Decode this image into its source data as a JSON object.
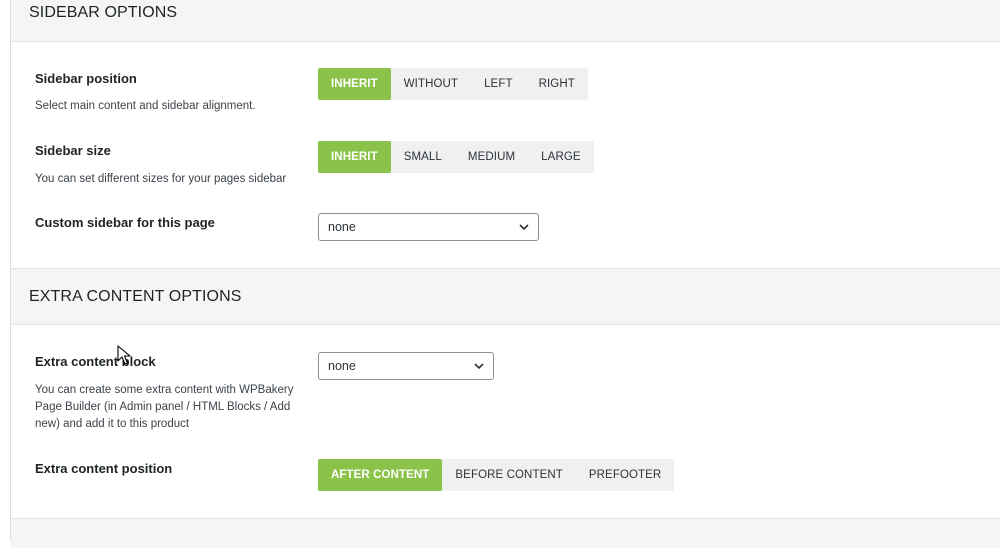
{
  "sidebar_section": {
    "title": "SIDEBAR OPTIONS",
    "position": {
      "label": "Sidebar position",
      "description": "Select main content and sidebar alignment.",
      "options": [
        "INHERIT",
        "WITHOUT",
        "LEFT",
        "RIGHT"
      ],
      "selected": "INHERIT"
    },
    "size": {
      "label": "Sidebar size",
      "description": "You can set different sizes for your pages sidebar",
      "options": [
        "INHERIT",
        "SMALL",
        "MEDIUM",
        "LARGE"
      ],
      "selected": "INHERIT"
    },
    "custom": {
      "label": "Custom sidebar for this page",
      "value": "none"
    }
  },
  "extra_section": {
    "title": "EXTRA CONTENT OPTIONS",
    "block": {
      "label": "Extra content block",
      "description_lines": [
        "You can create some extra content with WPBakery",
        "Page Builder (in Admin panel / HTML Blocks / Add",
        "new) and add it to this product"
      ],
      "value": "none"
    },
    "position": {
      "label": "Extra content position",
      "options": [
        "AFTER CONTENT",
        "BEFORE CONTENT",
        "PREFOOTER"
      ],
      "selected": "AFTER CONTENT"
    }
  },
  "colors": {
    "accent": "#8bc34a",
    "header_bg": "#f5f5f6"
  },
  "icons": {
    "dropdown": "chevron-down-icon",
    "pointer": "mouse-cursor-icon"
  }
}
